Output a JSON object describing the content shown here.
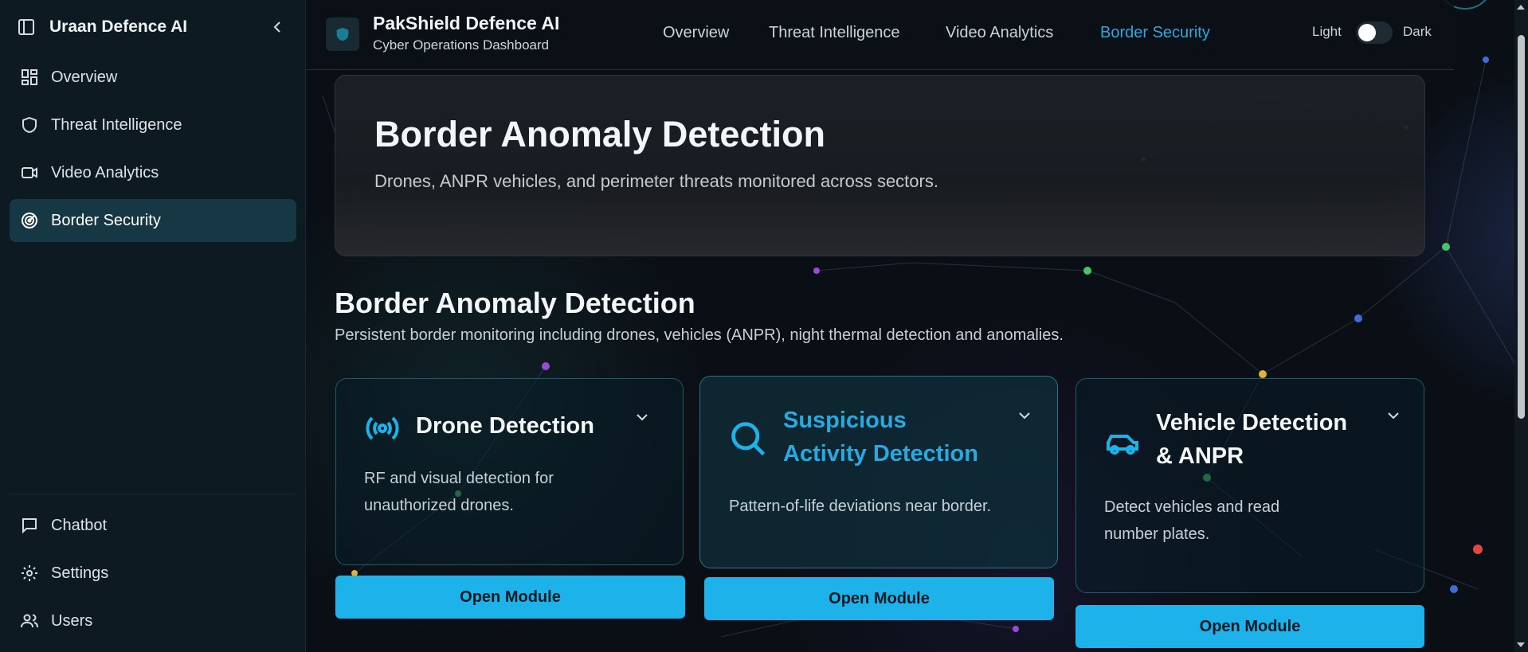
{
  "sidebar": {
    "brand": "Uraan Defence AI",
    "items": [
      {
        "label": "Overview"
      },
      {
        "label": "Threat Intelligence"
      },
      {
        "label": "Video Analytics"
      },
      {
        "label": "Border Security"
      }
    ],
    "bottom_items": [
      {
        "label": "Chatbot"
      },
      {
        "label": "Settings"
      },
      {
        "label": "Users"
      }
    ]
  },
  "header": {
    "title": "PakShield Defence AI",
    "subtitle": "Cyber Operations Dashboard",
    "nav": [
      {
        "label": "Overview"
      },
      {
        "label": "Threat Intelligence"
      },
      {
        "label": "Video Analytics"
      },
      {
        "label": "Border Security"
      }
    ],
    "theme_light": "Light",
    "theme_dark": "Dark"
  },
  "hero": {
    "title": "Border Anomaly Detection",
    "subtitle": "Drones, ANPR vehicles, and perimeter threats monitored across sectors."
  },
  "section": {
    "title": "Border Anomaly Detection",
    "subtitle": "Persistent border monitoring including drones, vehicles (ANPR), night thermal detection and anomalies."
  },
  "cards": [
    {
      "title": "Drone Detection",
      "desc_line1": "RF and visual detection for",
      "desc_line2": "unauthorized drones.",
      "button": "Open Module",
      "icon": "broadcast-icon"
    },
    {
      "title_line1": "Suspicious",
      "title_line2": "Activity Detection",
      "desc": "Pattern-of-life deviations near border.",
      "button": "Open Module",
      "icon": "search-icon"
    },
    {
      "title_line1": "Vehicle Detection",
      "title_line2": "& ANPR",
      "desc_line1": "Detect vehicles and read",
      "desc_line2": "number plates.",
      "button": "Open Module",
      "icon": "car-icon"
    }
  ],
  "colors": {
    "accent": "#1eb2ea",
    "active_nav": "#2aa8e0",
    "sidebar_bg": "#0d1a22"
  }
}
